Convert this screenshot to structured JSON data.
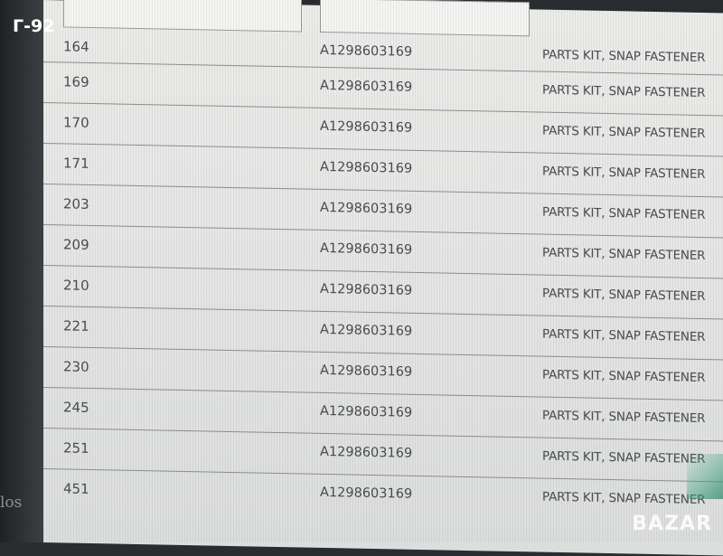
{
  "overlay": {
    "badge": "Г-92",
    "side_text": "los",
    "watermark": "BAZAR"
  },
  "table": {
    "rows": [
      {
        "pos": "164",
        "part": "A1298603169",
        "desc": "PARTS KIT, SNAP FASTENER"
      },
      {
        "pos": "169",
        "part": "A1298603169",
        "desc": "PARTS KIT, SNAP FASTENER"
      },
      {
        "pos": "170",
        "part": "A1298603169",
        "desc": "PARTS KIT, SNAP FASTENER"
      },
      {
        "pos": "171",
        "part": "A1298603169",
        "desc": "PARTS KIT, SNAP FASTENER"
      },
      {
        "pos": "203",
        "part": "A1298603169",
        "desc": "PARTS KIT, SNAP FASTENER"
      },
      {
        "pos": "209",
        "part": "A1298603169",
        "desc": "PARTS KIT, SNAP FASTENER"
      },
      {
        "pos": "210",
        "part": "A1298603169",
        "desc": "PARTS KIT, SNAP FASTENER"
      },
      {
        "pos": "221",
        "part": "A1298603169",
        "desc": "PARTS KIT, SNAP FASTENER"
      },
      {
        "pos": "230",
        "part": "A1298603169",
        "desc": "PARTS KIT, SNAP FASTENER"
      },
      {
        "pos": "245",
        "part": "A1298603169",
        "desc": "PARTS KIT, SNAP FASTENER"
      },
      {
        "pos": "251",
        "part": "A1298603169",
        "desc": "PARTS KIT, SNAP FASTENER"
      },
      {
        "pos": "451",
        "part": "A1298603169",
        "desc": "PARTS KIT, SNAP FASTENER"
      }
    ]
  }
}
